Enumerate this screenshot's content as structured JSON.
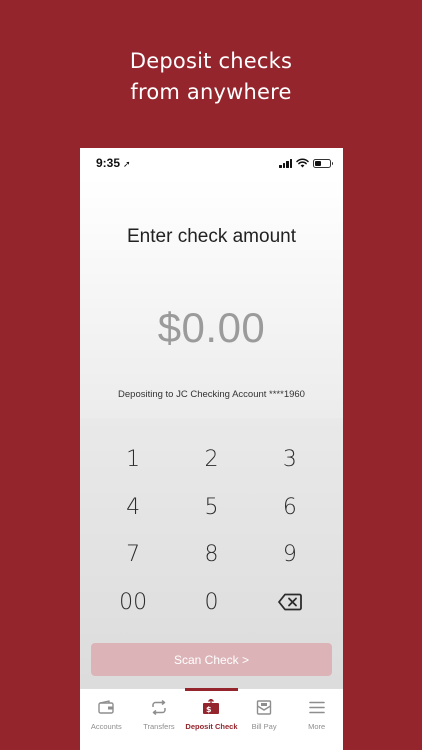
{
  "headline": {
    "line1": "Deposit checks",
    "line2": "from anywhere"
  },
  "status_bar": {
    "time": "9:35",
    "location_glyph": "➚"
  },
  "screen": {
    "title": "Enter check amount",
    "amount": "$0.00",
    "deposit_to": "Depositing to JC Checking Account ****1960"
  },
  "keypad": {
    "keys": [
      "1",
      "2",
      "3",
      "4",
      "5",
      "6",
      "7",
      "8",
      "9",
      "00",
      "0"
    ],
    "backspace_icon": "backspace-icon"
  },
  "scan_button": {
    "label": "Scan Check >"
  },
  "tabbar": {
    "tabs": [
      {
        "label": "Accounts",
        "icon": "wallet-icon"
      },
      {
        "label": "Transfers",
        "icon": "transfer-arrows-icon"
      },
      {
        "label": "Deposit Check",
        "icon": "deposit-check-icon",
        "active": true
      },
      {
        "label": "Bill Pay",
        "icon": "bill-envelope-icon"
      },
      {
        "label": "More",
        "icon": "menu-icon"
      }
    ]
  },
  "colors": {
    "brand": "#95252d",
    "scan_button_disabled": "#dcb4b8",
    "amount_text": "#9b9b9b"
  }
}
